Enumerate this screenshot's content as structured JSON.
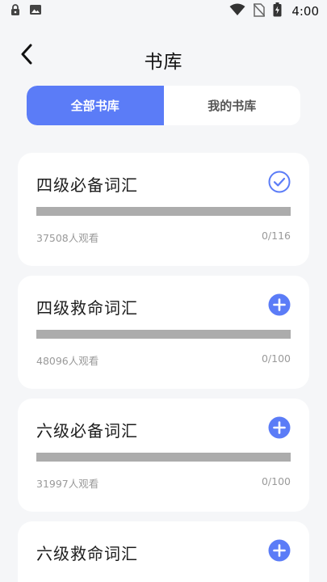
{
  "status_bar": {
    "time": "4:00",
    "left_icons": [
      "lock-icon",
      "image-icon"
    ],
    "right_icons": [
      "wifi-icon",
      "no-sim-icon",
      "battery-icon"
    ]
  },
  "header": {
    "title": "书库",
    "back_icon": "chevron-left-icon"
  },
  "tabs": [
    {
      "label": "全部书库",
      "active": true
    },
    {
      "label": "我的书库",
      "active": false
    }
  ],
  "books": [
    {
      "title": "四级必备词汇",
      "viewers": "37508人观看",
      "progress_text": "0/116",
      "progress": 0,
      "action_icon": "check-circle-icon"
    },
    {
      "title": "四级救命词汇",
      "viewers": "48096人观看",
      "progress_text": "0/100",
      "progress": 0,
      "action_icon": "add-circle-icon"
    },
    {
      "title": "六级必备词汇",
      "viewers": "31997人观看",
      "progress_text": "0/100",
      "progress": 0,
      "action_icon": "add-circle-icon"
    },
    {
      "title": "六级救命词汇",
      "action_icon": "add-circle-icon"
    }
  ],
  "colors": {
    "accent": "#5b7cf7",
    "background": "#f5f6f8",
    "card": "#ffffff",
    "track": "#acacac",
    "meta_text": "#9a9a9a"
  }
}
